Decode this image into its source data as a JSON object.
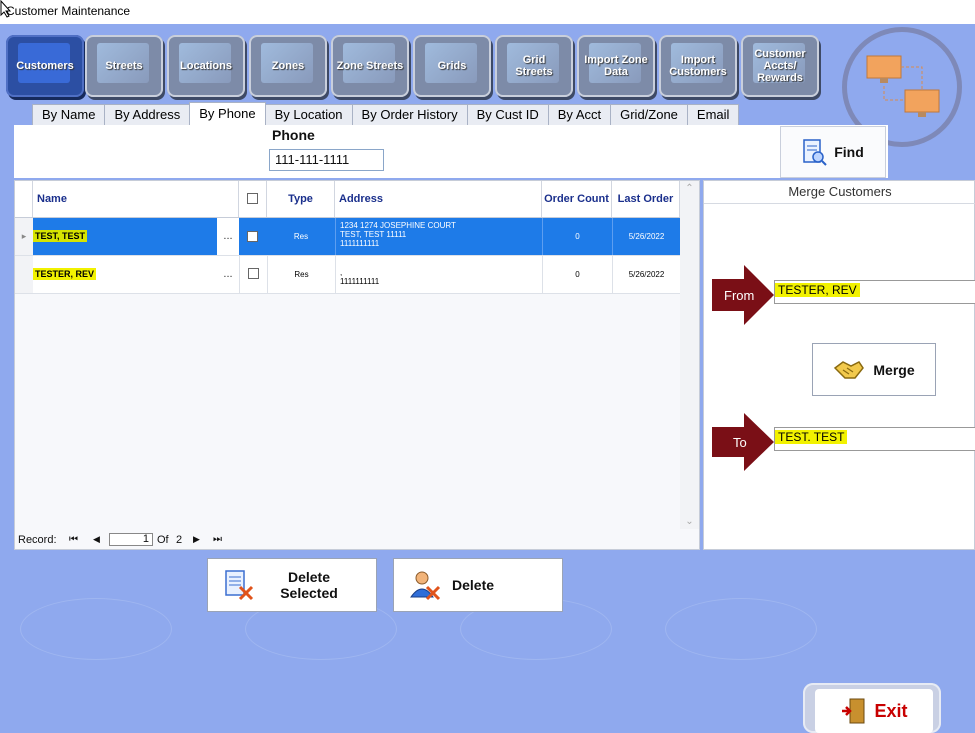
{
  "window": {
    "title": "Customer Maintenance"
  },
  "toolbar": {
    "buttons": [
      {
        "label": "Customers",
        "active": true
      },
      {
        "label": "Streets"
      },
      {
        "label": "Locations"
      },
      {
        "label": "Zones"
      },
      {
        "label": "Zone Streets"
      },
      {
        "label": "Grids"
      },
      {
        "label": "Grid Streets"
      },
      {
        "label": "Import Zone Data"
      },
      {
        "label": "Import Customers"
      },
      {
        "label": "Customer Accts/ Rewards"
      }
    ]
  },
  "tabs": [
    "By Name",
    "By Address",
    "By Phone",
    "By Location",
    "By Order History",
    "By Cust ID",
    "By Acct",
    "Grid/Zone",
    "Email"
  ],
  "active_tab": "By Phone",
  "search": {
    "label": "Phone",
    "value": "111-111-1111",
    "find_label": "Find"
  },
  "grid": {
    "columns": [
      "Name",
      "",
      "Type",
      "Address",
      "Order Count",
      "Last Order"
    ],
    "rows": [
      {
        "name": "TEST, TEST",
        "type": "Res",
        "address": [
          "1234 1274 JOSEPHINE COURT",
          "TEST, TEST 11111",
          "1111111111"
        ],
        "order_count": "0",
        "last_order": "5/26/2022",
        "selected": true,
        "ellipsis": "..."
      },
      {
        "name": "TESTER, REV",
        "type": "Res",
        "address": [
          ",",
          "1111111111"
        ],
        "order_count": "0",
        "last_order": "5/26/2022",
        "selected": false,
        "ellipsis": "..."
      }
    ],
    "record_nav": {
      "label": "Record:",
      "current": "1",
      "of_label": "Of",
      "total": "2"
    }
  },
  "merge": {
    "title": "Merge Customers",
    "from_label": "From",
    "from_value": "TESTER, REV",
    "to_label": "To",
    "to_value": "TEST. TEST",
    "merge_label": "Merge"
  },
  "actions": {
    "delete_selected_line1": "Delete",
    "delete_selected_line2": "Selected",
    "delete_label": "Delete",
    "exit_label": "Exit"
  },
  "colors": {
    "background": "#8fa9ee",
    "selected_row": "#1e7be8",
    "highlight": "#f2f200",
    "arrow": "#7a0f16"
  }
}
